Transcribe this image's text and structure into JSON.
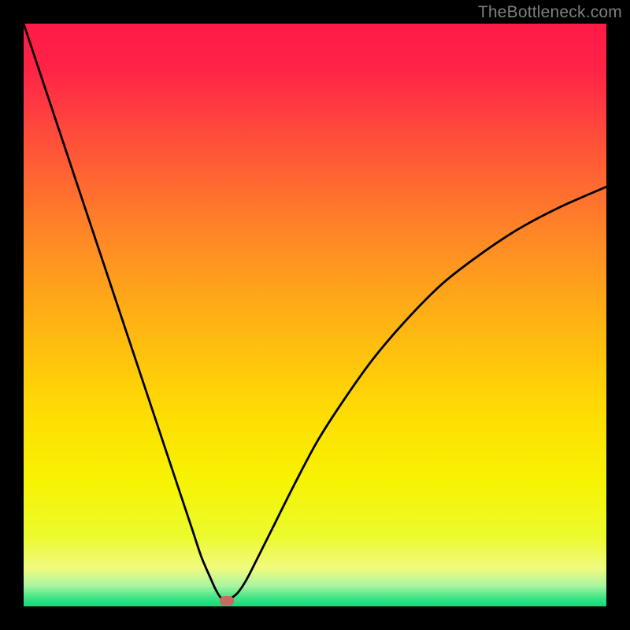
{
  "watermark": {
    "text": "TheBottleneck.com"
  },
  "chart_data": {
    "type": "line",
    "title": "",
    "xlabel": "",
    "ylabel": "",
    "xlim": [
      0,
      100
    ],
    "ylim": [
      0,
      100
    ],
    "grid": false,
    "background_gradient": {
      "direction": "vertical",
      "stops": [
        {
          "pos": 0.0,
          "color": "#ff1a48"
        },
        {
          "pos": 0.08,
          "color": "#ff2447"
        },
        {
          "pos": 0.2,
          "color": "#ff4f3a"
        },
        {
          "pos": 0.35,
          "color": "#ff8328"
        },
        {
          "pos": 0.5,
          "color": "#ffb015"
        },
        {
          "pos": 0.65,
          "color": "#ffd805"
        },
        {
          "pos": 0.78,
          "color": "#f7f300"
        },
        {
          "pos": 0.88,
          "color": "#ecfa2e"
        },
        {
          "pos": 0.935,
          "color": "#f0fb80"
        },
        {
          "pos": 0.965,
          "color": "#a8f5a0"
        },
        {
          "pos": 0.985,
          "color": "#3fe486"
        },
        {
          "pos": 1.0,
          "color": "#16d97a"
        }
      ]
    },
    "series": [
      {
        "name": "bottleneck-curve",
        "color": "#000000",
        "width": 2.8,
        "x": [
          0.0,
          2.0,
          4.5,
          7.0,
          9.5,
          12.0,
          14.5,
          17.0,
          19.5,
          22.0,
          24.5,
          27.0,
          29.0,
          30.5,
          32.0,
          33.0,
          33.9,
          34.8,
          35.5,
          36.8,
          38.2,
          40.0,
          43.0,
          46.5,
          50.5,
          55.0,
          60.0,
          66.0,
          72.0,
          78.5,
          85.0,
          92.0,
          100.0
        ],
        "y": [
          100.0,
          94.0,
          86.5,
          79.0,
          71.5,
          64.0,
          56.5,
          49.0,
          41.5,
          34.0,
          26.5,
          19.0,
          13.0,
          8.5,
          5.0,
          2.8,
          1.4,
          0.9,
          1.3,
          2.4,
          4.5,
          8.0,
          14.0,
          21.0,
          28.5,
          35.5,
          42.5,
          49.5,
          55.5,
          60.5,
          64.8,
          68.5,
          72.0
        ]
      }
    ],
    "minimum_marker": {
      "x": 34.8,
      "y": 0.9,
      "color": "#c9695f"
    }
  }
}
